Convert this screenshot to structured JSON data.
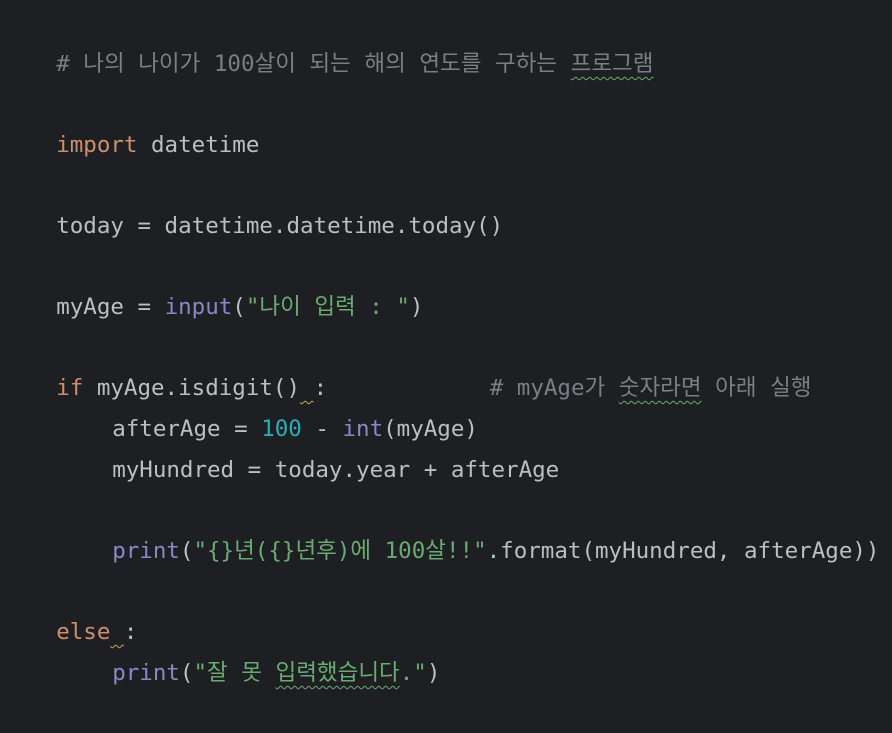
{
  "code": {
    "line1": {
      "comment_main": "# 나의 나이가 100살이 되는 해의 연도를 구하는 ",
      "comment_typo": "프로그램"
    },
    "line2": {
      "kw": "import",
      "sp": " ",
      "module": "datetime"
    },
    "line3": {
      "text": "today = datetime.datetime.today()"
    },
    "line4": {
      "var": "myAge = ",
      "fn": "input",
      "open": "(",
      "str": "\"나이 입력 : \"",
      "close": ")"
    },
    "line5": {
      "kw": "if",
      "cond": " myAge.isdigit()",
      "warn_space": " ",
      "colon": ":",
      "gap": "            ",
      "comment_a": "# myAge가 ",
      "comment_typo": "숫자라면",
      "comment_b": " 아래 실행"
    },
    "line6": {
      "var": "afterAge = ",
      "num": "100",
      "op": " - ",
      "fn": "int",
      "rest": "(myAge)"
    },
    "line7": {
      "text": "myHundred = today.year + afterAge"
    },
    "line8": {
      "fn": "print",
      "open": "(",
      "str": "\"{}년({}년후)에 100살!!\"",
      "rest": ".format(myHundred, afterAge))"
    },
    "line9": {
      "kw": "else",
      "warn_space": " ",
      "colon": ":"
    },
    "line10": {
      "fn": "print",
      "open": "(",
      "str_a": "\"잘 못 ",
      "str_typo": "입력했습니다",
      "str_b": ".\"",
      "close": ")"
    }
  },
  "colors": {
    "background": "#1e1f22",
    "text": "#bcbec4",
    "comment": "#7a7e85",
    "keyword": "#cf8e6d",
    "builtin": "#8888c6",
    "string": "#6aab73",
    "number": "#2aacb8"
  }
}
